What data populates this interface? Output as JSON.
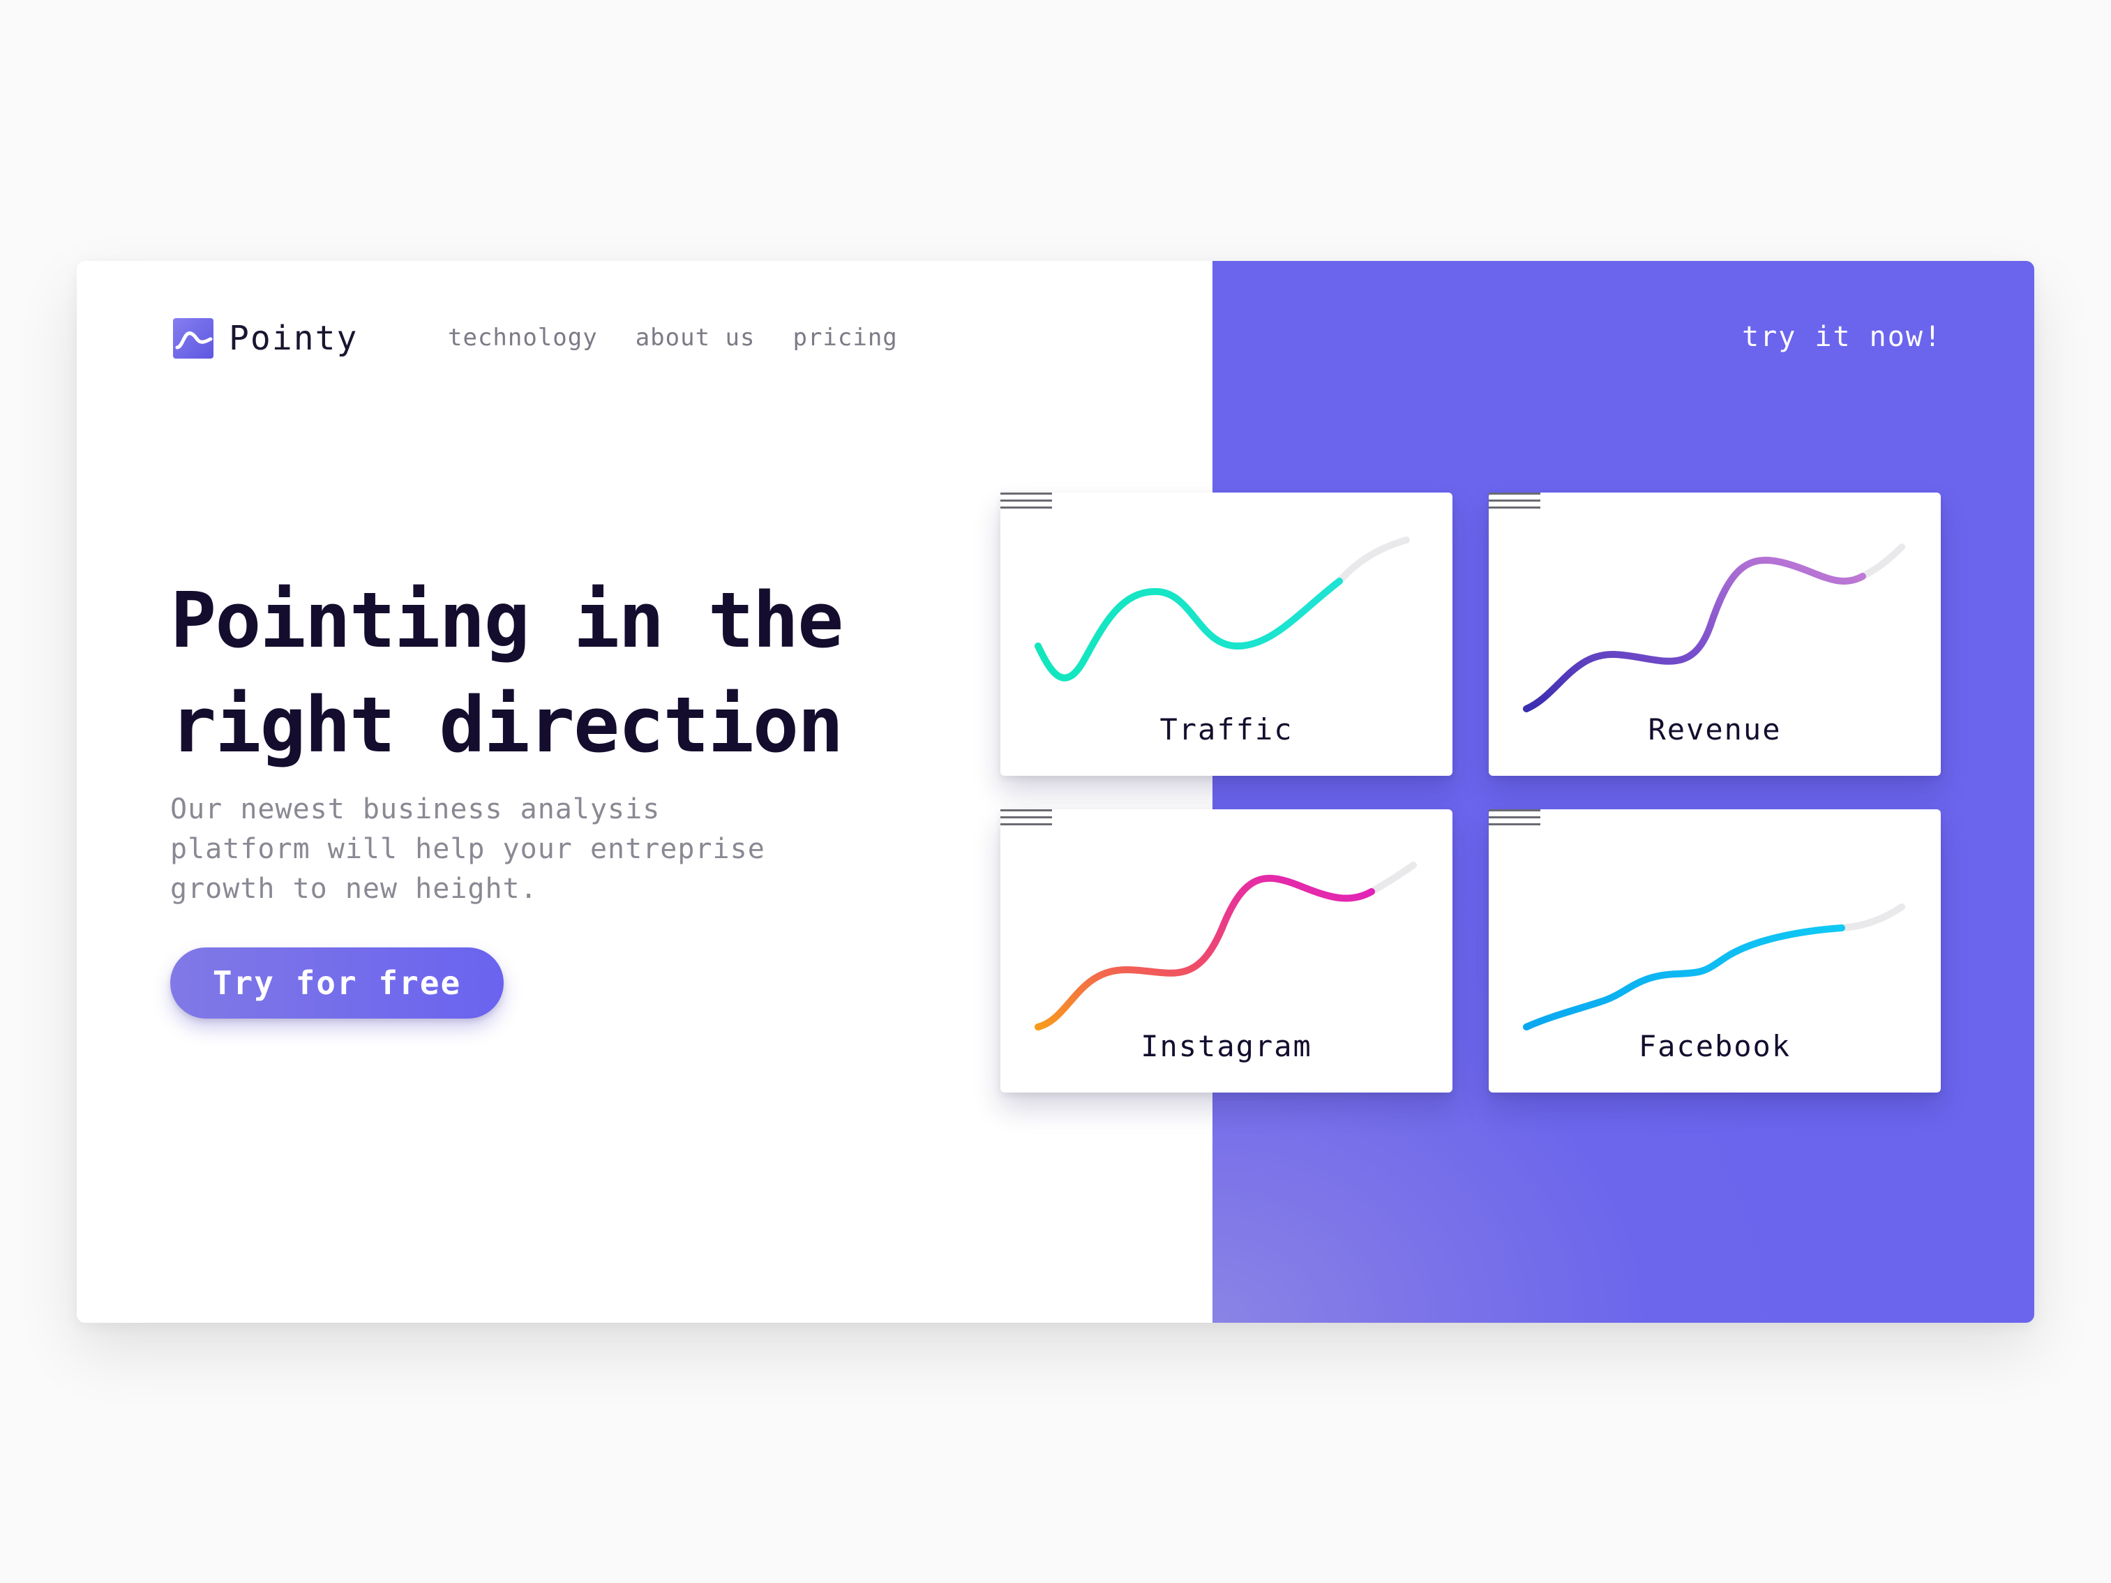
{
  "brand": {
    "name": "Pointy",
    "icon": "wave-logo-icon",
    "accent": "#6c66ec"
  },
  "nav": {
    "links": [
      "technology",
      "about us",
      "pricing"
    ],
    "cta": "try it now!"
  },
  "hero": {
    "title_line1": "Pointing in the",
    "title_line2": "right direction",
    "subtitle_line1": "Our newest business analysis",
    "subtitle_line2": "platform will help your entreprise",
    "subtitle_line3": "growth to new height.",
    "button": "Try for free"
  },
  "cards": [
    {
      "label": "Traffic",
      "menu_icon": "hamburger-menu-icon",
      "colors": [
        "#12e6bd",
        "#1de3d4"
      ]
    },
    {
      "label": "Revenue",
      "menu_icon": "hamburger-menu-icon",
      "colors": [
        "#3a2db0",
        "#c77ed6"
      ]
    },
    {
      "label": "Instagram",
      "menu_icon": "hamburger-menu-icon",
      "colors": [
        "#f79a1c",
        "#e81fa7"
      ]
    },
    {
      "label": "Facebook",
      "menu_icon": "hamburger-menu-icon",
      "colors": [
        "#0aa8f0",
        "#10c9f4"
      ]
    }
  ]
}
